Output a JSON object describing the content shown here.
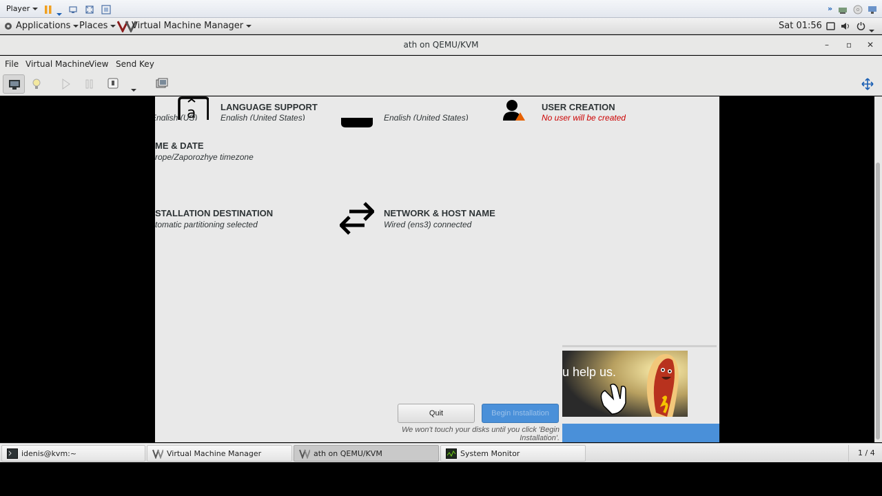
{
  "player_bar": {
    "player_label": "Player"
  },
  "gnome_bar": {
    "applications": "Applications",
    "places": "Places",
    "app_menu": "Virtual Machine Manager",
    "clock": "Sat 01:56"
  },
  "window": {
    "title": "ath on QEMU/KVM",
    "controls": {
      "minimize": "–",
      "maximize": "▫",
      "close": "✕"
    }
  },
  "menu": {
    "items": [
      "File",
      "Virtual Machine",
      "View",
      "Send Key"
    ]
  },
  "installer": {
    "spokes": {
      "language": {
        "title": "LANGUAGE SUPPORT",
        "subtitle": "English (United States)"
      },
      "keyboard_left_sub": "English (US)",
      "keyboard_sub": "English (United States)",
      "user": {
        "title": "USER CREATION",
        "subtitle": "No user will be created"
      },
      "datetime": {
        "title": "ME & DATE",
        "subtitle": "rope/Zaporozhye timezone"
      },
      "destination": {
        "title": "STALLATION DESTINATION",
        "subtitle": "tomatic partitioning selected"
      },
      "network": {
        "title": "NETWORK & HOST NAME",
        "subtitle": "Wired (ens3) connected"
      }
    },
    "promo_text": "u help us.",
    "quit_label": "Quit",
    "begin_label": "Begin Installation",
    "disk_note": "We won't touch your disks until you click 'Begin Installation'."
  },
  "taskbar": {
    "tasks": [
      {
        "label": "idenis@kvm:~"
      },
      {
        "label": "Virtual Machine Manager"
      },
      {
        "label": "ath on QEMU/KVM"
      },
      {
        "label": "System Monitor"
      }
    ],
    "workspace": "1 / 4"
  }
}
